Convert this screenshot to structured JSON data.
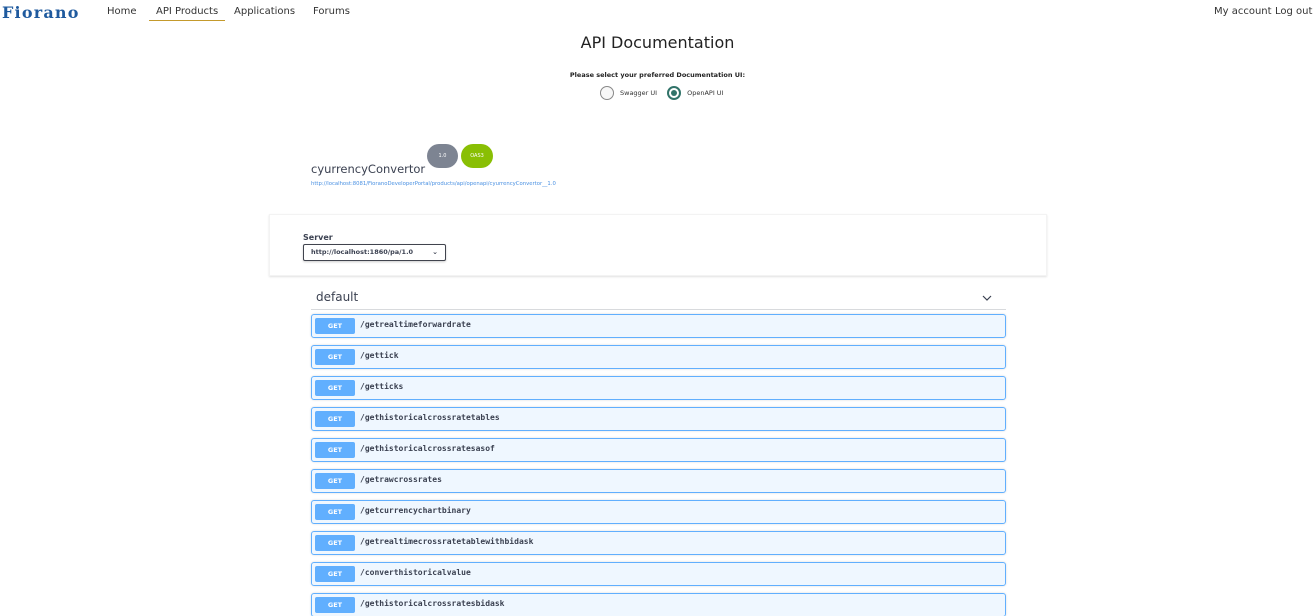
{
  "nav": {
    "logo_text": "Fiorano",
    "items": [
      "Home",
      "API Products",
      "Applications",
      "Forums"
    ],
    "active": "API Products",
    "right": [
      "My account",
      "Log out"
    ]
  },
  "page": {
    "title": "API Documentation",
    "select_label": "Please select your preferred Documentation UI:",
    "options": [
      "Swagger UI",
      "OpenAPI UI"
    ],
    "selected_option": "OpenAPI UI"
  },
  "info": {
    "title": "cyurrencyConvertor",
    "version_badge": "1.0",
    "oas_badge": "OAS3",
    "url": "http://localhost:8081/FioranoDeveloperPortal/products/api/openapi/cyurrencyConvertor__1.0"
  },
  "server": {
    "label": "Server",
    "selected": "http://localhost:1860/pa/1.0"
  },
  "tag": {
    "name": "default",
    "expanded": true
  },
  "operations": [
    {
      "method": "GET",
      "path": "/getrealtimeforwardrate"
    },
    {
      "method": "GET",
      "path": "/gettick"
    },
    {
      "method": "GET",
      "path": "/getticks"
    },
    {
      "method": "GET",
      "path": "/gethistoricalcrossratetables"
    },
    {
      "method": "GET",
      "path": "/gethistoricalcrossratesasof"
    },
    {
      "method": "GET",
      "path": "/getrawcrossrates"
    },
    {
      "method": "GET",
      "path": "/getcurrencychartbinary"
    },
    {
      "method": "GET",
      "path": "/getrealtimecrossratetablewithbidask"
    },
    {
      "method": "GET",
      "path": "/converthistoricalvalue"
    },
    {
      "method": "GET",
      "path": "/gethistoricalcrossratesbidask"
    }
  ],
  "colors": {
    "get_method": "#61affe",
    "logo": "#1f5a9e",
    "radio_checked": "#317369",
    "oas_badge": "#89bf04",
    "version_badge": "#7d8492"
  }
}
